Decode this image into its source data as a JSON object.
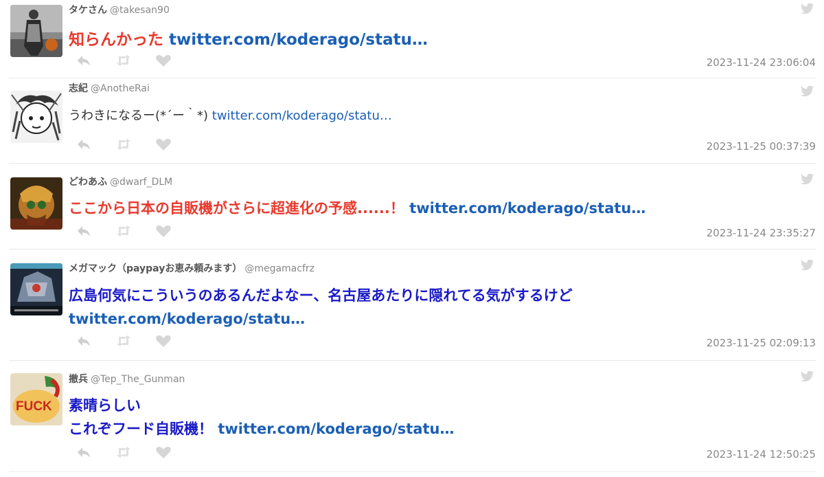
{
  "tweets": [
    {
      "name": "タケさん",
      "handle": "@takesan90",
      "text": "知らんかった",
      "link": "twitter.com/koderago/statu…",
      "timestamp": "2023-11-24 23:06:04",
      "icons": {
        "avatar": "avatar-image",
        "reply": "reply-icon",
        "retweet": "retweet-icon",
        "like": "heart-icon",
        "source": "twitter-bird-icon"
      }
    },
    {
      "name": "志紀",
      "handle": "@AnotheRai",
      "text": "うわきになるー(*´ー｀*)",
      "link": "twitter.com/koderago/statu…",
      "timestamp": "2023-11-25 00:37:39",
      "icons": {
        "avatar": "avatar-image",
        "reply": "reply-icon",
        "retweet": "retweet-icon",
        "like": "heart-icon",
        "source": "twitter-bird-icon"
      }
    },
    {
      "name": "どわあふ",
      "handle": "@dwarf_DLM",
      "text": "ここから日本の自販機がさらに超進化の予感......！",
      "link": "twitter.com/koderago/statu…",
      "timestamp": "2023-11-24 23:35:27",
      "icons": {
        "avatar": "avatar-image",
        "reply": "reply-icon",
        "retweet": "retweet-icon",
        "like": "heart-icon",
        "source": "twitter-bird-icon"
      }
    },
    {
      "name": "メガマック（paypayお恵み頼みます）",
      "handle": "@megamacfrz",
      "text": "広島何気にこういうのあるんだよなー、名古屋あたりに隠れてる気がするけど",
      "link": "twitter.com/koderago/statu…",
      "timestamp": "2023-11-25 02:09:13",
      "icons": {
        "avatar": "avatar-image",
        "reply": "reply-icon",
        "retweet": "retweet-icon",
        "like": "heart-icon",
        "source": "twitter-bird-icon"
      }
    },
    {
      "name": "撤兵",
      "handle": "@Tep_The_Gunman",
      "text_line1": "素晴らしい",
      "text_line2": "これぞフード自販機！",
      "link": "twitter.com/koderago/statu…",
      "timestamp": "2023-11-24 12:50:25",
      "avatar_text": "FUCK",
      "icons": {
        "avatar": "avatar-image",
        "reply": "reply-icon",
        "retweet": "retweet-icon",
        "like": "heart-icon",
        "source": "twitter-bird-icon"
      }
    }
  ],
  "colors": {
    "highlight_red": "#e83a2e",
    "highlight_blue": "#1a1ac8",
    "link": "#1b5fb5",
    "meta": "#888888",
    "icon": "#cccccc"
  }
}
